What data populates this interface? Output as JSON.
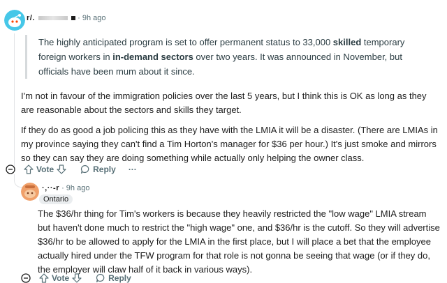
{
  "comment1": {
    "username": "r/.",
    "time": "9h ago",
    "quote": {
      "seg1": "The highly anticipated program is set to offer permanent status to 33,000 ",
      "bold1": "skilled",
      "seg2": " temporary foreign workers in ",
      "bold2": "in-demand sectors",
      "seg3": " over two years. It was announced in November, but officials have been mum about it since."
    },
    "para1": "I'm not in favour of the immigration policies over the last 5 years, but I think this is OK as long as they are reasonable about the sectors and skills they target.",
    "para2": "If they do as good a job policing this as they have with the LMIA it will be a disaster. (There are LMIAs in my province saying they can't find a Tim Horton's manager for $36 per hour.) It's just smoke and mirrors so they can say they are doing something while actually only helping the owner class.",
    "actions": {
      "vote": "Vote",
      "reply": "Reply",
      "more": "···"
    }
  },
  "comment2": {
    "username": "·,··-r",
    "time": "9h ago",
    "flair": "Ontario",
    "body": "The $36/hr thing for Tim's workers is because they heavily restricted the \"low wage\" LMIA stream but haven't done much to restrict the \"high wage\" one, and $36/hr is the cutoff. So they will advertise $36/hr to be allowed to apply for the LMIA in the first place, but I will place a bet that the employee actually hired under the TFW program for that role is not gonna be seeing that wage (or if they do, the employer will claw half of it back in various ways).",
    "actions": {
      "vote": "Vote",
      "reply": "Reply"
    }
  },
  "colors": {
    "avatar1": "#46c7e8",
    "avatar2": "#f0a06a",
    "thread": "#e1e3e5"
  }
}
